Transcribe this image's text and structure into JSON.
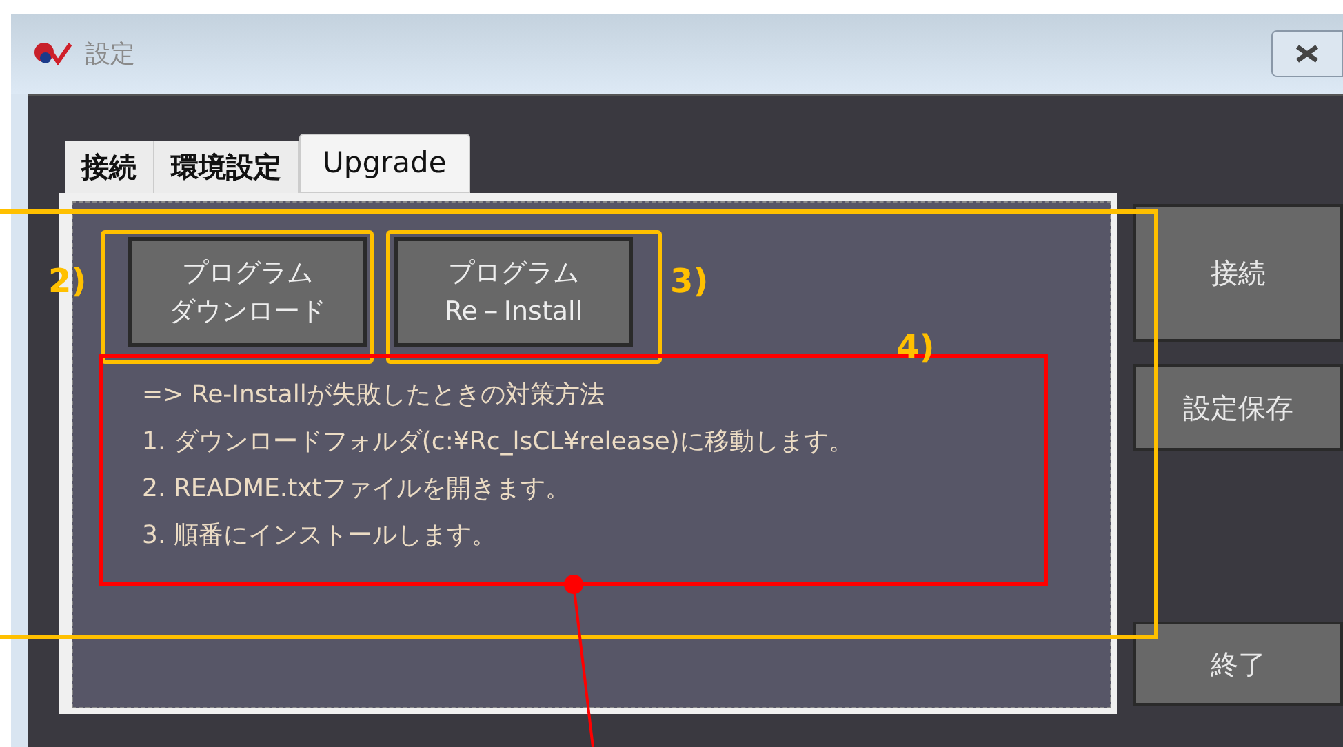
{
  "window": {
    "title": "設定"
  },
  "tabs": [
    {
      "label": "接続",
      "selected": false
    },
    {
      "label": "環境設定",
      "selected": false
    },
    {
      "label": "Upgrade",
      "selected": true
    }
  ],
  "panel_buttons": [
    {
      "lines": [
        "プログラム",
        "ダウンロード"
      ]
    },
    {
      "lines": [
        "プログラム",
        "Re－Install"
      ]
    }
  ],
  "notes": [
    "=> Re-Installが失敗したときの対策方法",
    "1. ダウンロードフォルダ(c:¥Rc_lsCL¥release)に移動します。",
    "2. README.txtファイルを開きます。",
    "3. 順番にインストールします。"
  ],
  "side_buttons": [
    {
      "label": "接続",
      "kind": "tall"
    },
    {
      "label": "設定保存",
      "kind": "short"
    },
    {
      "label": "終了",
      "kind": "bottom"
    }
  ],
  "annotations": [
    {
      "label": "2)"
    },
    {
      "label": "3)"
    },
    {
      "label": "4)"
    }
  ]
}
